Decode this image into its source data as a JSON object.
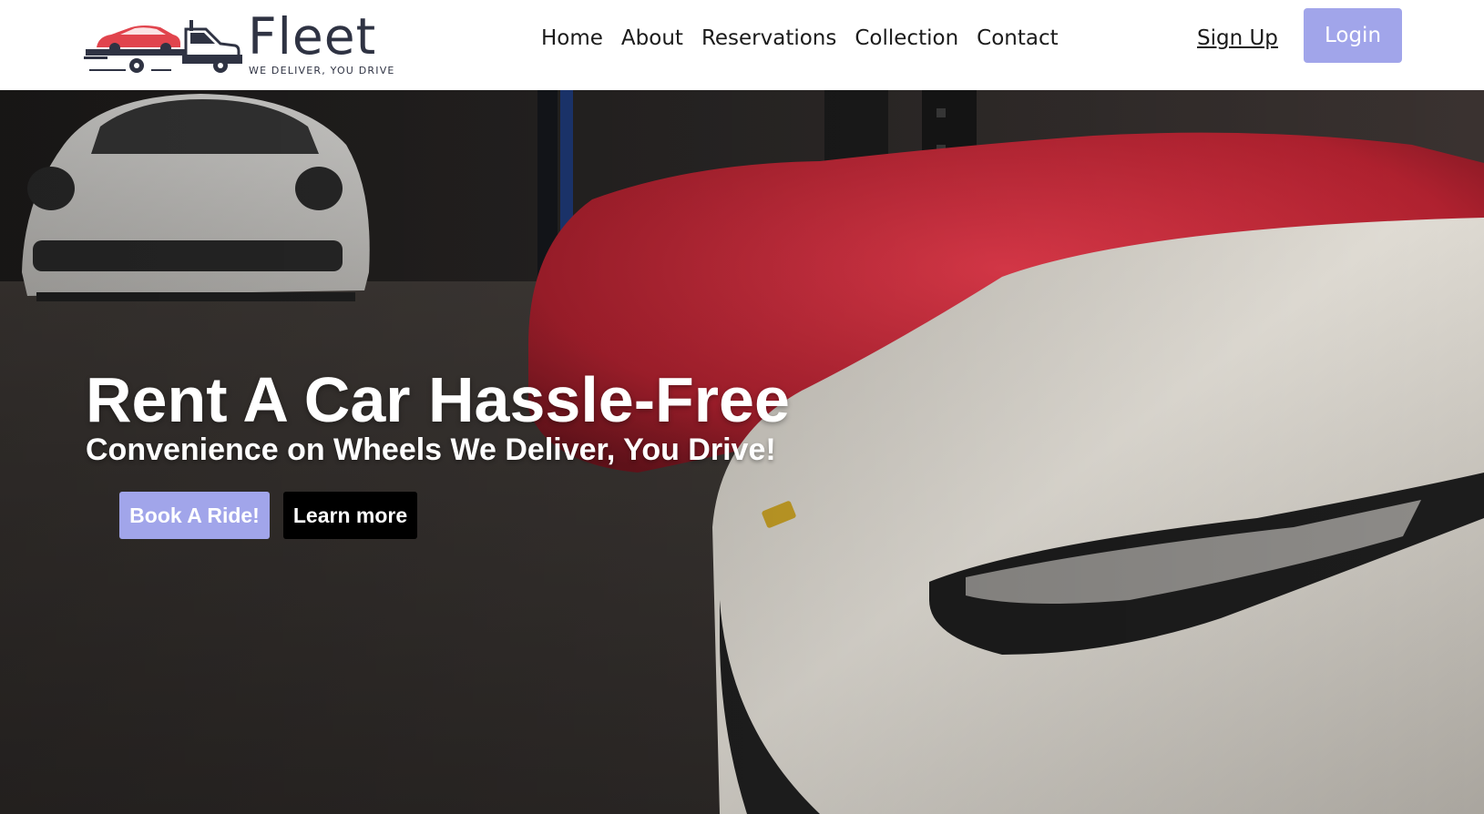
{
  "brand": {
    "name": "Fleet",
    "tagline": "WE DELIVER, YOU DRIVE",
    "colors": {
      "accent": "#a1a5ea",
      "text_dark": "#2f3343",
      "truck_car": "#e1444d"
    }
  },
  "nav": {
    "links": [
      "Home",
      "About",
      "Reservations",
      "Collection",
      "Contact"
    ],
    "signup_label": "Sign Up",
    "login_label": "Login"
  },
  "hero": {
    "title": "Rent A Car Hassle-Free",
    "subtitle": "Convenience on Wheels We Deliver, You Drive!",
    "primary_button": "Book A Ride!",
    "secondary_button": "Learn more",
    "image_description_icon": "cars-garage-photo"
  }
}
